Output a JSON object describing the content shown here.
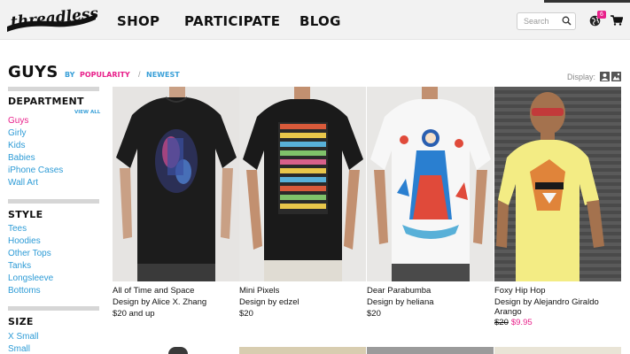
{
  "brand": {
    "name": "threadless"
  },
  "nav": {
    "items": [
      "SHOP",
      "PARTICIPATE",
      "BLOG"
    ]
  },
  "search": {
    "placeholder": "Search"
  },
  "notifications": {
    "count": "6"
  },
  "colors": {
    "accent_pink": "#e8208a",
    "accent_blue": "#3aa0d8",
    "header_bg": "#f2f2f2"
  },
  "page": {
    "title": "GUYS",
    "sort_prefix": "BY",
    "sort_options": [
      "POPULARITY",
      "NEWEST"
    ],
    "sort_separator": "/",
    "display_label": "Display:"
  },
  "sidebar": {
    "department": {
      "heading": "DEPARTMENT",
      "view_all": "VIEW ALL",
      "items": [
        "Guys",
        "Girly",
        "Kids",
        "Babies",
        "iPhone Cases",
        "Wall Art"
      ],
      "active": "Guys"
    },
    "style": {
      "heading": "STYLE",
      "items": [
        "Tees",
        "Hoodies",
        "Other Tops",
        "Tanks",
        "Longsleeve",
        "Bottoms"
      ]
    },
    "size": {
      "heading": "SIZE",
      "items": [
        "X Small",
        "Small"
      ]
    }
  },
  "products": [
    {
      "name": "All of Time and Space",
      "by": "Design by Alice X. Zhang",
      "price": "$20 and up"
    },
    {
      "name": "Mini Pixels",
      "by": "Design by edzel",
      "price": "$20"
    },
    {
      "name": "Dear Parabumba",
      "by": "Design by heliana",
      "price": "$20"
    },
    {
      "name": "Foxy Hip Hop",
      "by": "Design by Alejandro Giraldo",
      "by_line2": "Arango",
      "old_price": "$20",
      "sale_price": "$9.95"
    }
  ]
}
